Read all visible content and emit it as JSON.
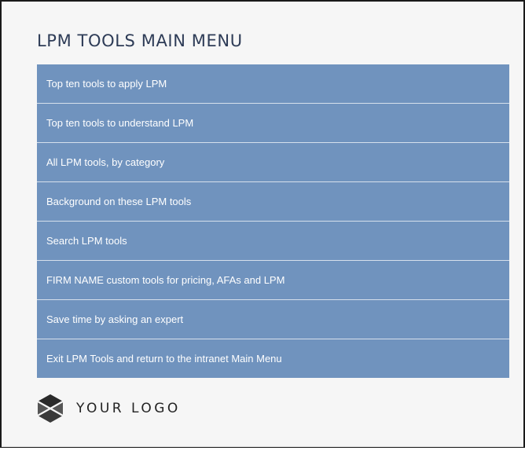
{
  "page": {
    "title": "LPM TOOLS MAIN MENU"
  },
  "menu": {
    "items": [
      {
        "label": "Top ten tools to apply LPM"
      },
      {
        "label": "Top ten tools to understand LPM"
      },
      {
        "label": "All LPM tools, by category"
      },
      {
        "label": "Background on these LPM tools"
      },
      {
        "label": "Search LPM tools"
      },
      {
        "label": "FIRM NAME custom tools for pricing, AFAs and LPM"
      },
      {
        "label": "Save time by asking an expert"
      },
      {
        "label": "Exit LPM Tools and return to the intranet Main Menu"
      }
    ]
  },
  "logo": {
    "text": "YOUR LOGO",
    "icon": "hexagon-cube-icon"
  },
  "colors": {
    "menu_bg": "#7093be",
    "menu_divider": "#d6e0ec",
    "title": "#2e3c57",
    "page_bg": "#f6f6f6"
  }
}
